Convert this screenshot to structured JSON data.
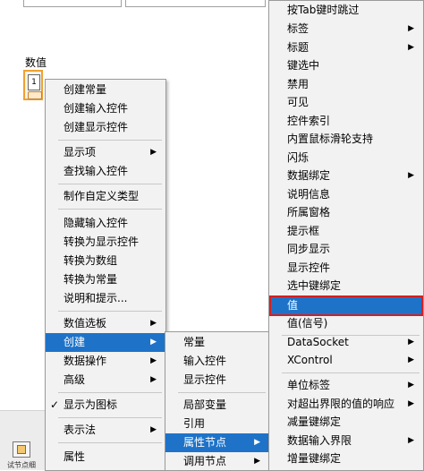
{
  "numeric_control": {
    "label": "数值",
    "glyph": "1"
  },
  "bottom_text": "试节点细",
  "context_menu": {
    "items": [
      {
        "label": "创建常量"
      },
      {
        "label": "创建输入控件"
      },
      {
        "label": "创建显示控件"
      },
      {
        "label": "显示项",
        "submenu": true
      },
      {
        "label": "查找输入控件"
      },
      {
        "label": "制作自定义类型"
      },
      {
        "label": "隐藏输入控件"
      },
      {
        "label": "转换为显示控件"
      },
      {
        "label": "转换为数组"
      },
      {
        "label": "转换为常量"
      },
      {
        "label": "说明和提示..."
      },
      {
        "label": "数值选板",
        "submenu": true
      },
      {
        "label": "创建",
        "submenu": true,
        "selected": true
      },
      {
        "label": "数据操作",
        "submenu": true
      },
      {
        "label": "高级",
        "submenu": true
      },
      {
        "label": "显示为图标",
        "checked": true
      },
      {
        "label": "表示法",
        "submenu": true
      },
      {
        "label": "属性"
      }
    ]
  },
  "create_submenu": {
    "items": [
      {
        "label": "常量"
      },
      {
        "label": "输入控件"
      },
      {
        "label": "显示控件"
      },
      {
        "label": "局部变量"
      },
      {
        "label": "引用"
      },
      {
        "label": "属性节点",
        "submenu": true,
        "selected": true
      },
      {
        "label": "调用节点",
        "submenu": true
      }
    ]
  },
  "property_submenu": {
    "items": [
      {
        "label": "按Tab键时跳过"
      },
      {
        "label": "标签",
        "submenu": true
      },
      {
        "label": "标题",
        "submenu": true
      },
      {
        "label": "键选中"
      },
      {
        "label": "禁用"
      },
      {
        "label": "可见"
      },
      {
        "label": "控件索引"
      },
      {
        "label": "内置鼠标滑轮支持"
      },
      {
        "label": "闪烁"
      },
      {
        "label": "数据绑定",
        "submenu": true
      },
      {
        "label": "说明信息"
      },
      {
        "label": "所属窗格"
      },
      {
        "label": "提示框"
      },
      {
        "label": "同步显示"
      },
      {
        "label": "显示控件"
      },
      {
        "label": "选中键绑定"
      },
      {
        "label": "值",
        "selected": true,
        "highlighted": true
      },
      {
        "label": "值(信号)"
      },
      {
        "label": "DataSocket",
        "submenu": true
      },
      {
        "label": "XControl",
        "submenu": true
      },
      {
        "label": "单位标签",
        "submenu": true
      },
      {
        "label": "对超出界限的值的响应",
        "submenu": true
      },
      {
        "label": "减量键绑定"
      },
      {
        "label": "数据输入界限",
        "submenu": true
      },
      {
        "label": "增量键绑定"
      }
    ]
  },
  "colors": {
    "selection": "#1e73c8",
    "highlight_border": "#d42020",
    "control_border": "#f0a030"
  },
  "glyphs": {
    "arrow": "▶",
    "check": "✓"
  }
}
